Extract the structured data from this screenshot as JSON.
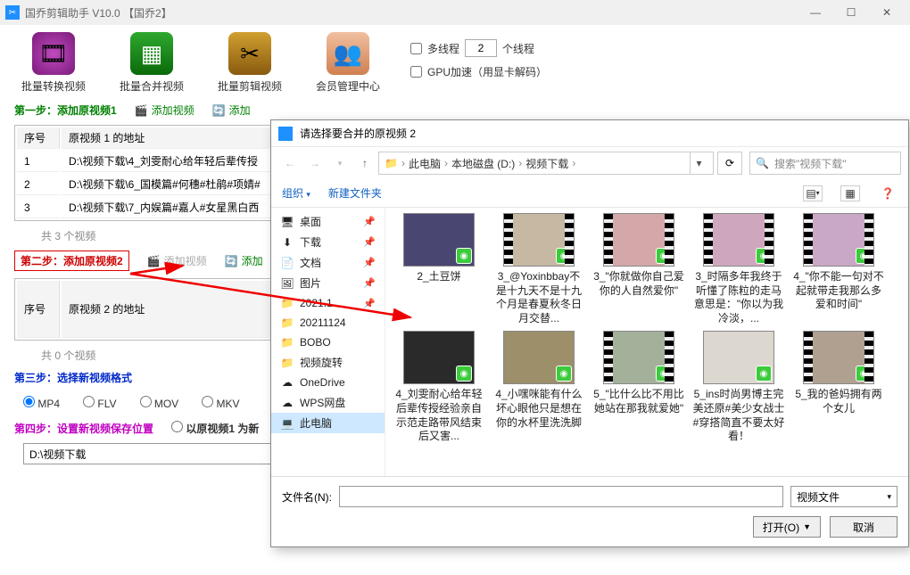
{
  "window": {
    "title": "国乔剪辑助手 V10.0 【国乔2】"
  },
  "toolbar": {
    "items": [
      "批量转换视频",
      "批量合并视频",
      "批量剪辑视频",
      "会员管理中心"
    ],
    "multiThreadLabel": "多线程",
    "threadsValue": "2",
    "threadsUnit": "个线程",
    "gpuLabel": "GPU加速（用显卡解码）"
  },
  "steps": {
    "s1": "第一步：添加原视频1",
    "addVideo": "添加视频",
    "addBatch": "添加",
    "s2": "第二步：添加原视频2",
    "s3": "第三步：选择新视频格式",
    "s4": "第四步：设置新视频保存位置",
    "useVid1NewLabel": "以原视频1 为新"
  },
  "table1": {
    "headers": [
      "序号",
      "原视频 1 的地址"
    ],
    "rows": [
      [
        "1",
        "D:\\视频下载\\4_刘雯耐心给年轻后辈传授"
      ],
      [
        "2",
        "D:\\视频下载\\6_国模篇#何穗#杜鹃#项婧#"
      ],
      [
        "3",
        "D:\\视频下载\\7_内娱篇#嘉人#女星黑白西"
      ]
    ],
    "count": "共 3 个视频",
    "addOpt": "添加"
  },
  "table2": {
    "headers": [
      "序号",
      "原视频 2 的地址"
    ],
    "rows": [],
    "count": "共 0 个视频"
  },
  "formats": [
    "MP4",
    "FLV",
    "MOV",
    "MKV"
  ],
  "savePath": "D:\\视频下载",
  "dialog": {
    "title": "请选择要合并的原视频 2",
    "breadcrumb": [
      "此电脑",
      "本地磁盘 (D:)",
      "视频下载"
    ],
    "searchPlaceholder": "搜索\"视频下载\"",
    "toolbar": {
      "organize": "组织",
      "newFolder": "新建文件夹"
    },
    "side": [
      {
        "label": "桌面",
        "icon": "🖥",
        "pin": true
      },
      {
        "label": "下载",
        "icon": "⬇",
        "pin": true
      },
      {
        "label": "文档",
        "icon": "📄",
        "pin": true
      },
      {
        "label": "图片",
        "icon": "🖼",
        "pin": true
      },
      {
        "label": "2021.1..",
        "icon": "📁",
        "pin": true
      },
      {
        "label": "20211124",
        "icon": "📁"
      },
      {
        "label": "BOBO",
        "icon": "📁"
      },
      {
        "label": "视频旋转",
        "icon": "📁"
      },
      {
        "label": "OneDrive",
        "icon": "☁"
      },
      {
        "label": "WPS网盘",
        "icon": "☁"
      },
      {
        "label": "此电脑",
        "icon": "💻",
        "sel": true
      }
    ],
    "files": [
      {
        "name": "2_土豆饼",
        "bg": "#4a4672"
      },
      {
        "name": "3_@Yoxinbbay不是十九天不是十九个月是春夏秋冬日月交替...",
        "film": true,
        "bg": "#c7b8a3"
      },
      {
        "name": "3_\"你就做你自己爱你的人自然爱你\"",
        "film": true,
        "bg": "#d4a8a8"
      },
      {
        "name": "3_时隔多年我终于听懂了陈粒的走马意思是：\"你以为我冷淡，...",
        "film": true,
        "bg": "#cfa7bc"
      },
      {
        "name": "4_\"你不能一句对不起就带走我那么多爱和时间\"",
        "film": true,
        "bg": "#c9a7c6"
      },
      {
        "name": "4_刘雯耐心给年轻后辈传授经验亲自示范走路带风结束后又害...",
        "bg": "#2a2a2a"
      },
      {
        "name": "4_小嘿咪能有什么坏心眼他只是想在你的水杯里洗洗脚",
        "bg": "#9c8f6a"
      },
      {
        "name": "5_\"比什么比不用比她站在那我就爱她\"",
        "film": true,
        "bg": "#a3b19a"
      },
      {
        "name": "5_ins时尚男博主完美还原#美少女战士#穿搭简直不要太好看！",
        "bg": "#dcd7cf"
      },
      {
        "name": "5_我的爸妈拥有两个女儿",
        "film": true,
        "bg": "#b0a090"
      }
    ],
    "fileNameLabel": "文件名(N):",
    "fileNameValue": "",
    "fileType": "视频文件",
    "openBtn": "打开(O)",
    "cancelBtn": "取消"
  }
}
